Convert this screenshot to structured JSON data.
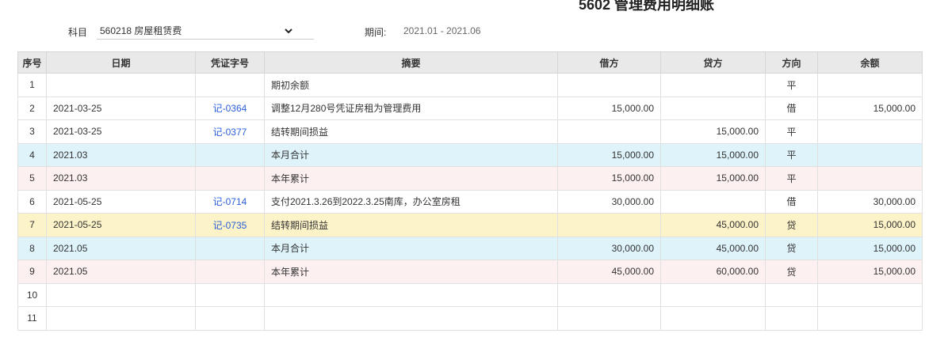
{
  "report": {
    "title": "5602 管理费用明细账"
  },
  "filters": {
    "subject_label": "科目",
    "subject_value": "560218 房屋租赁费",
    "period_label": "期间:",
    "period_value": "2021.01 - 2021.06"
  },
  "table": {
    "headers": [
      "序号",
      "日期",
      "凭证字号",
      "摘要",
      "借方",
      "贷方",
      "方向",
      "余额"
    ],
    "rows": [
      {
        "no": "1",
        "date": "",
        "voucher": "",
        "summary": "期初余额",
        "debit": "",
        "credit": "",
        "direction": "平",
        "balance": "",
        "style": "normal"
      },
      {
        "no": "2",
        "date": "2021-03-25",
        "voucher": "记-0364",
        "summary": "调整12月280号凭证房租为管理费用",
        "debit": "15,000.00",
        "credit": "",
        "direction": "借",
        "balance": "15,000.00",
        "style": "normal"
      },
      {
        "no": "3",
        "date": "2021-03-25",
        "voucher": "记-0377",
        "summary": "结转期间损益",
        "debit": "",
        "credit": "15,000.00",
        "direction": "平",
        "balance": "",
        "style": "normal"
      },
      {
        "no": "4",
        "date": "2021.03",
        "voucher": "",
        "summary": "本月合计",
        "debit": "15,000.00",
        "credit": "15,000.00",
        "direction": "平",
        "balance": "",
        "style": "month"
      },
      {
        "no": "5",
        "date": "2021.03",
        "voucher": "",
        "summary": "本年累计",
        "debit": "15,000.00",
        "credit": "15,000.00",
        "direction": "平",
        "balance": "",
        "style": "year"
      },
      {
        "no": "6",
        "date": "2021-05-25",
        "voucher": "记-0714",
        "summary": "支付2021.3.26到2022.3.25南库，办公室房租",
        "debit": "30,000.00",
        "credit": "",
        "direction": "借",
        "balance": "30,000.00",
        "style": "normal"
      },
      {
        "no": "7",
        "date": "2021-05-25",
        "voucher": "记-0735",
        "summary": "结转期间损益",
        "debit": "",
        "credit": "45,000.00",
        "direction": "贷",
        "balance": "15,000.00",
        "style": "selected"
      },
      {
        "no": "8",
        "date": "2021.05",
        "voucher": "",
        "summary": "本月合计",
        "debit": "30,000.00",
        "credit": "45,000.00",
        "direction": "贷",
        "balance": "15,000.00",
        "style": "month"
      },
      {
        "no": "9",
        "date": "2021.05",
        "voucher": "",
        "summary": "本年累计",
        "debit": "45,000.00",
        "credit": "60,000.00",
        "direction": "贷",
        "balance": "15,000.00",
        "style": "year"
      },
      {
        "no": "10",
        "date": "",
        "voucher": "",
        "summary": "",
        "debit": "",
        "credit": "",
        "direction": "",
        "balance": "",
        "style": "normal"
      },
      {
        "no": "11",
        "date": "",
        "voucher": "",
        "summary": "",
        "debit": "",
        "credit": "",
        "direction": "",
        "balance": "",
        "style": "normal"
      }
    ]
  },
  "icons": {
    "subject_dropdown": "chevron-down-icon"
  },
  "colors": {
    "link": "#2b5fd9",
    "month_total_row": "#dff3fa",
    "year_total_row": "#fdf0f0",
    "selected_row": "#fdf3c8",
    "header_bg": "#e9e9e9"
  }
}
